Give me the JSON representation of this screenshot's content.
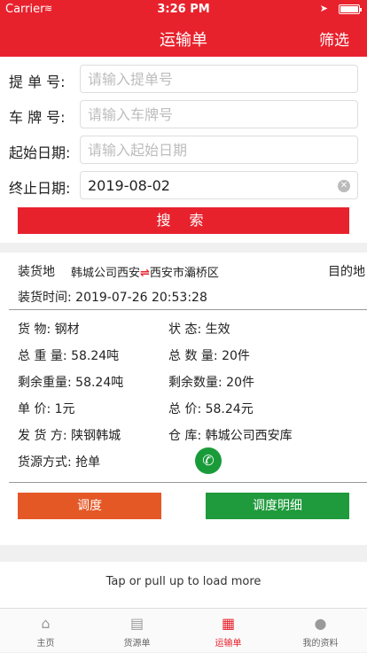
{
  "status": {
    "carrier": "Carrier",
    "time": "3:26 PM"
  },
  "nav": {
    "title": "运输单",
    "filter": "筛选"
  },
  "form": {
    "bill_label": "提 单 号:",
    "bill_placeholder": "请输入提单号",
    "plate_label": "车 牌 号:",
    "plate_placeholder": "请输入车牌号",
    "start_label": "起始日期:",
    "start_placeholder": "请输入起始日期",
    "end_label": "终止日期:",
    "end_value": "2019-08-02",
    "search": "搜 索"
  },
  "order": {
    "loading_label": "装货地",
    "from": "韩城公司西安",
    "arrow": "⇌",
    "to": "西安市灞桥区",
    "dest_label": "目的地",
    "load_time": "装货时间:   2019-07-26 20:53:28",
    "goods": "货      物: 钢材",
    "state": "状      态: 生效",
    "total_weight": "总 重 量: 58.24吨",
    "total_qty": "总 数 量: 20件",
    "remain_weight": "剩余重量: 58.24吨",
    "remain_qty": "剩余数量: 20件",
    "unit_price": "单      价: 1元",
    "total_price": "总      价: 58.24元",
    "shipper": "发 货 方: 陕钢韩城",
    "warehouse": "仓      库: 韩城公司西安库",
    "source": "货源方式: 抢单",
    "dispatch": "调度",
    "dispatch_detail": "调度明细"
  },
  "load_more": "Tap or pull up to load more",
  "tabs": [
    {
      "label": "主页",
      "icon": "home-icon"
    },
    {
      "label": "货源单",
      "icon": "clipboard-icon"
    },
    {
      "label": "运输单",
      "icon": "transport-doc-icon"
    },
    {
      "label": "我的资料",
      "icon": "user-icon"
    }
  ],
  "colors": {
    "brand": "#e8222d",
    "orange": "#e45826",
    "green": "#1f9a3c"
  }
}
